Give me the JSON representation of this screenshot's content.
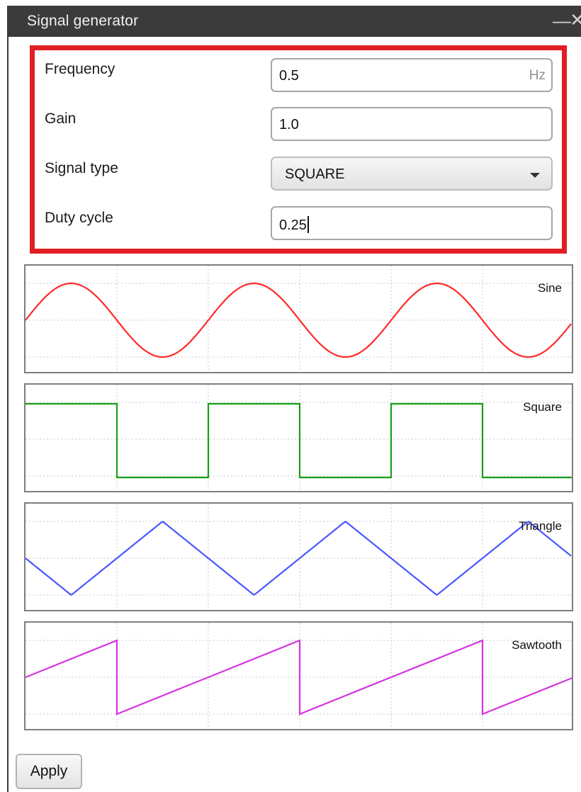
{
  "window": {
    "title": "Signal generator",
    "minimize_glyph": "—",
    "close_glyph": "✕"
  },
  "form": {
    "frequency": {
      "label": "Frequency",
      "value": "0.5",
      "unit": "Hz"
    },
    "gain": {
      "label": "Gain",
      "value": "1.0"
    },
    "signal_type": {
      "label": "Signal type",
      "value": "SQUARE"
    },
    "duty_cycle": {
      "label": "Duty cycle",
      "value": "0.25"
    }
  },
  "colors": {
    "highlight": "#e01e24",
    "sine": "#ff2a2a",
    "square": "#1a9e1a",
    "triangle": "#4a55ff",
    "sawtooth": "#d633e0"
  },
  "plots": [
    {
      "label": "Sine",
      "wave": "sine",
      "color": "#ff2a2a"
    },
    {
      "label": "Square",
      "wave": "square",
      "color": "#1a9e1a"
    },
    {
      "label": "Triangle",
      "wave": "triangle",
      "color": "#4a55ff"
    },
    {
      "label": "Sawtooth",
      "wave": "sawtooth",
      "color": "#d633e0"
    }
  ],
  "buttons": {
    "apply": "Apply"
  }
}
